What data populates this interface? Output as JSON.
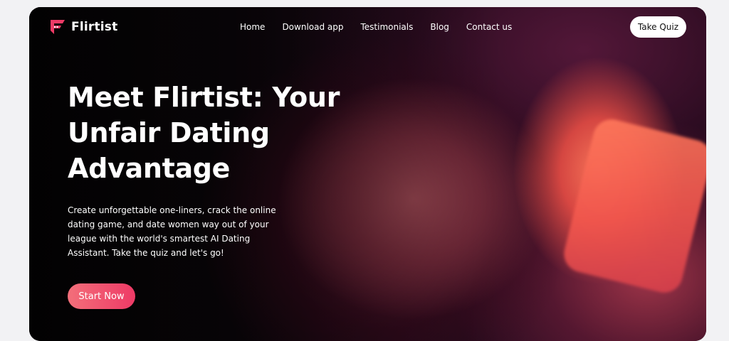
{
  "brand": {
    "name": "Flirtist",
    "logo_icon": "flirtist-logo-icon",
    "accent_color": "#ee3a66"
  },
  "nav": {
    "items": [
      {
        "label": "Home"
      },
      {
        "label": "Download app"
      },
      {
        "label": "Testimonials"
      },
      {
        "label": "Blog"
      },
      {
        "label": "Contact us"
      }
    ],
    "cta_label": "Take Quiz"
  },
  "hero": {
    "headline": "Meet Flirtist: Your Unfair Dating Advantage",
    "subtext": "Create unforgettable one-liners, crack the online dating game, and date women way out of your league with the world's smartest AI Dating Assistant. Take the quiz and let's go!",
    "cta_label": "Start Now",
    "background_image": "woman-looking-at-phone-photo"
  }
}
